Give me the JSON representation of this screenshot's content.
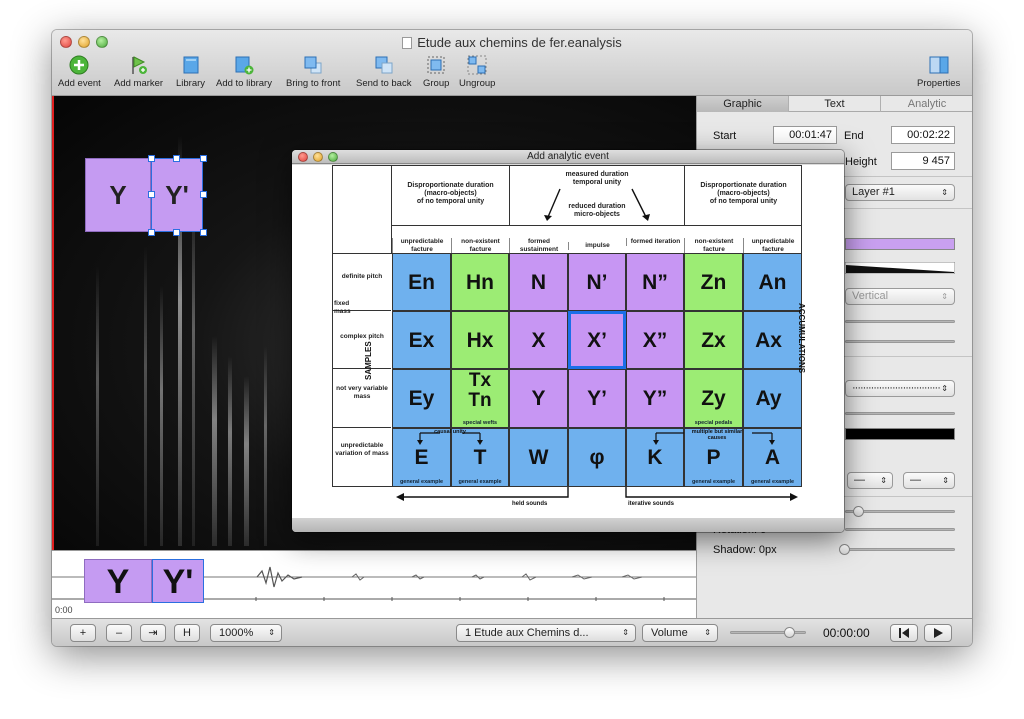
{
  "window": {
    "title": "Etude aux chemins de fer.eanalysis"
  },
  "toolbar": {
    "add_event": "Add event",
    "add_marker": "Add marker",
    "library": "Library",
    "add_to_library": "Add to library",
    "bring_to_front": "Bring to front",
    "send_to_back": "Send to back",
    "group": "Group",
    "ungroup": "Ungroup",
    "properties": "Properties"
  },
  "canvas": {
    "box_y": "Y",
    "box_y_prime": "Y'"
  },
  "timeline": {
    "start_time": "0:00",
    "box_y": "Y",
    "box_y_prime": "Y'"
  },
  "bottom_bar": {
    "plus": "+",
    "minus": "–",
    "jump": "⇥",
    "fit": "H",
    "zoom": "1000%",
    "track": "1 Etude aux Chemins d...",
    "volume": "Volume",
    "time": "00:00:00"
  },
  "inspector": {
    "tabs": [
      "Graphic",
      "Text",
      "Analytic"
    ],
    "start_label": "Start",
    "start_value": "00:01:47",
    "end_label": "End",
    "end_value": "00:02:22",
    "height_label": "Height",
    "height_value": "9 457",
    "layer": "Layer #1",
    "orientation": "Vertical",
    "shadow_label": "Shadow: 0px",
    "rotation_label": "Rotation: 0°"
  },
  "dialog": {
    "title": "Add analytic event",
    "group_headers": {
      "left": "Disproportionate duration\n(macro-objects)\nof no temporal unity",
      "center_top": "measured duration\ntemporal unity",
      "center_bottom": "reduced duration\nmicro-objects",
      "right": "Disproportionate duration\n(macro-objects)\nof no temporal unity"
    },
    "column_headers": [
      "unpredictable facture",
      "non-existent facture",
      "formed sustainment",
      "impulse",
      "formed iteration",
      "non-existent facture",
      "unpredictable facture"
    ],
    "row_headers": {
      "definite_pitch": "definite pitch",
      "fixed_mass": "fixed mass",
      "complex_pitch": "complex pitch",
      "not_variable": "not very variable mass",
      "unpredictable": "unpredictable variation of mass"
    },
    "side_labels": {
      "left": "SAMPLES",
      "right": "ACCUMULATIONS"
    },
    "rows": [
      [
        "En",
        "Hn",
        "N",
        "N’",
        "N”",
        "Zn",
        "An"
      ],
      [
        "Ex",
        "Hx",
        "X",
        "X’",
        "X”",
        "Zx",
        "Ax"
      ],
      [
        "Ey",
        "Tx Tn",
        "Y",
        "Y’",
        "Y”",
        "Zy",
        "Ay"
      ],
      [
        "E",
        "T",
        "W",
        "φ",
        "K",
        "P",
        "A"
      ]
    ],
    "notes": {
      "special_wefts": "special wefts",
      "special_pedals": "special pedals",
      "general_example": "general example",
      "causal_unity": "causal unity",
      "multiple_causes": "multiple but similar causes"
    },
    "footer": {
      "held_sounds": "held sounds",
      "iterative_sounds": "iterative sounds"
    }
  },
  "colors": {
    "blue": "#6fb1ee",
    "green": "#9cec74",
    "purple": "#c796f3",
    "selection": "#1a6fe8"
  }
}
